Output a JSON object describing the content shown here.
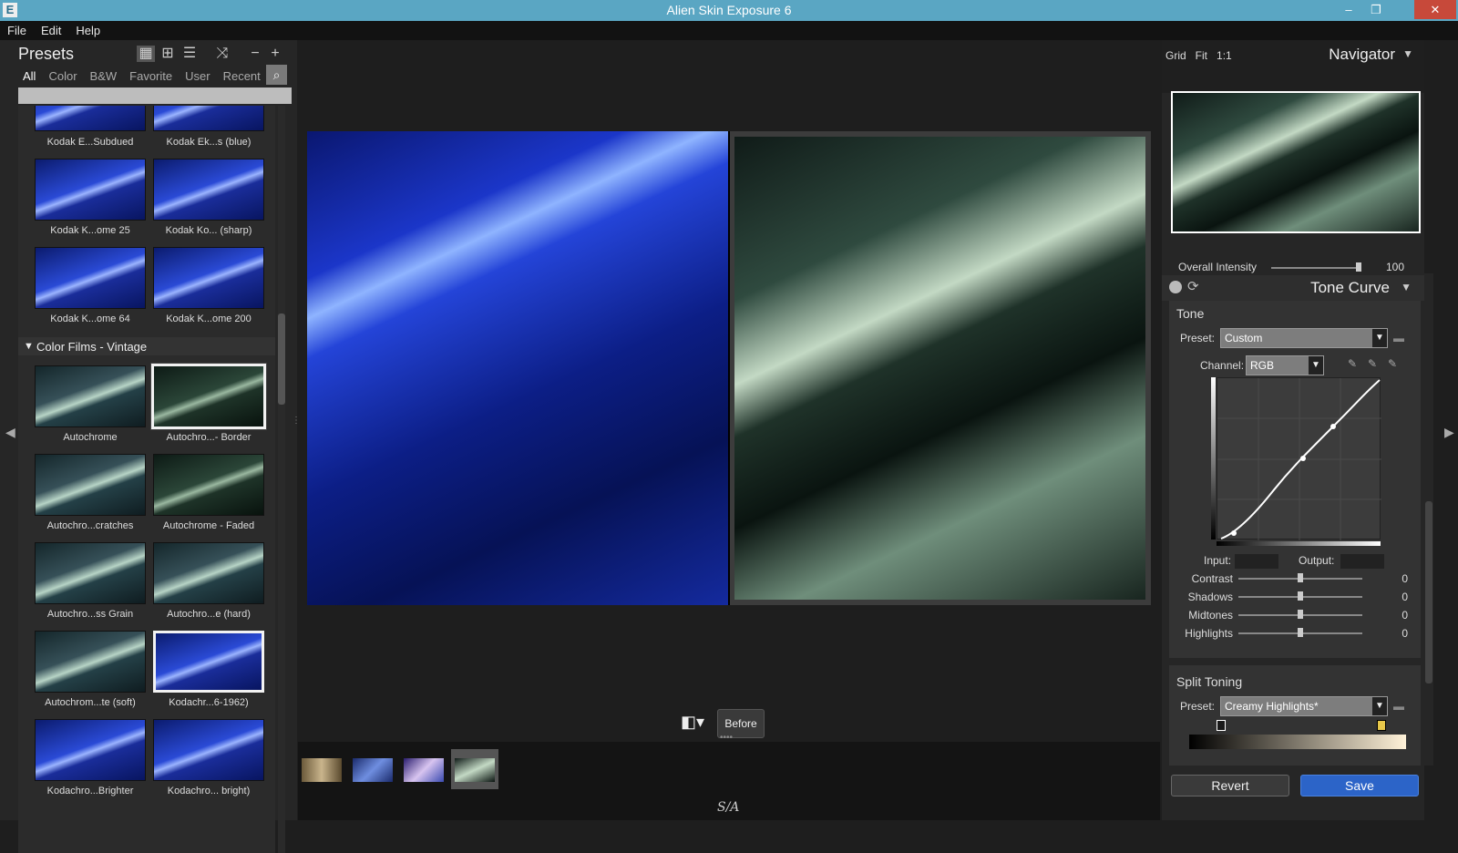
{
  "window": {
    "title": "Alien Skin Exposure 6",
    "app_icon": "E"
  },
  "menu": [
    "File",
    "Edit",
    "Help"
  ],
  "presets": {
    "title": "Presets",
    "tabs": [
      "All",
      "Color",
      "B&W",
      "Favorite",
      "User",
      "Recent"
    ],
    "section": "Color Films - Vintage",
    "top_items": [
      "Kodak E...Subdued",
      "Kodak Ek...s (blue)",
      "Kodak K...ome 25",
      "Kodak Ko... (sharp)",
      "Kodak K...ome 64",
      "Kodak K...ome 200"
    ],
    "vintage_items": [
      "Autochrome",
      "Autochro...- Border",
      "Autochro...cratches",
      "Autochrome - Faded",
      "Autochro...ss Grain",
      "Autochro...e (hard)",
      "Autochrom...te (soft)",
      "Kodachr...6-1962)",
      "Kodachro...Brighter",
      "Kodachro... bright)"
    ]
  },
  "center": {
    "compare_label": "Before",
    "logo": "S/A"
  },
  "navigator": {
    "title": "Navigator",
    "zoom": [
      "Grid",
      "Fit",
      "1:1"
    ]
  },
  "intensity": {
    "label": "Overall Intensity",
    "value": "100",
    "level": 1.0
  },
  "tone_curve": {
    "title": "Tone Curve",
    "section": "Tone",
    "preset_label": "Preset:",
    "preset_value": "Custom",
    "channel_label": "Channel:",
    "channel_value": "RGB",
    "input_label": "Input:",
    "output_label": "Output:",
    "sliders": [
      {
        "label": "Contrast",
        "value": "0"
      },
      {
        "label": "Shadows",
        "value": "0"
      },
      {
        "label": "Midtones",
        "value": "0"
      },
      {
        "label": "Highlights",
        "value": "0"
      }
    ]
  },
  "split_toning": {
    "title": "Split Toning",
    "preset_label": "Preset:",
    "preset_value": "Creamy Highlights*"
  },
  "footer": {
    "revert": "Revert",
    "save": "Save"
  },
  "colors": {
    "titlebar": "#5aa6c3",
    "save": "#2c64c8",
    "close": "#c7493a"
  }
}
